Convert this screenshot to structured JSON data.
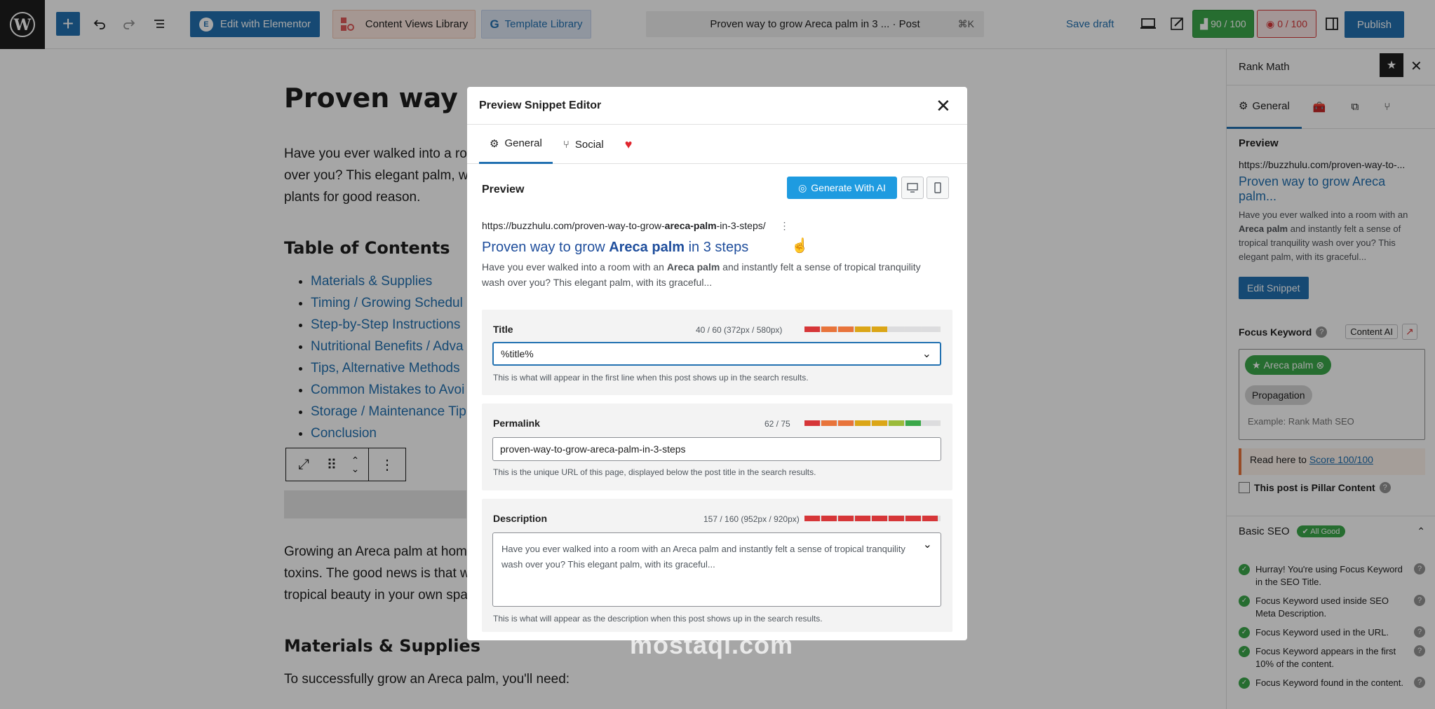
{
  "topbar": {
    "add_label": "+",
    "elementor_label": "Edit with Elementor",
    "elementor_logo": "E",
    "content_views_label": "Content Views Library",
    "template_library_label": "Template Library",
    "command_text": "Proven way to grow Areca palm in 3 ... · Post",
    "command_shortcut": "⌘K",
    "save_draft": "Save draft",
    "seo_score": "90 / 100",
    "readability_score": "0 / 100",
    "publish": "Publish"
  },
  "editor": {
    "title": "Proven way to g",
    "intro_lines": [
      "Have you ever walked into a ro",
      "over you? This elegant palm, w",
      "plants for good reason."
    ],
    "toc_heading": "Table of Contents",
    "toc_items": [
      "Materials & Supplies",
      "Timing / Growing Schedul",
      "Step-by-Step Instructions",
      "Nutritional Benefits / Adva",
      "Tips, Alternative Methods",
      "Common Mistakes to Avoi",
      "Storage / Maintenance Tip",
      "Conclusion"
    ],
    "body_lines": [
      "Growing an Areca palm at hom",
      "toxins. The good news is that w",
      "tropical beauty in your own spa"
    ],
    "materials_heading": "Materials & Supplies",
    "materials_text": "To successfully grow an Areca palm, you'll need:"
  },
  "sidebar": {
    "title": "Rank Math",
    "tab_general": "General",
    "preview_label": "Preview",
    "preview_url": "https://buzzhulu.com/proven-way-to-...",
    "preview_title": "Proven way to grow Areca palm...",
    "preview_desc_1": "Have you ever walked into a room with an",
    "preview_desc_bold": "Areca palm",
    "preview_desc_2": "and instantly felt a sense of tropical tranquility wash over you? This elegant palm, with its graceful...",
    "edit_snippet": "Edit Snippet",
    "focus_keyword_label": "Focus Keyword",
    "content_ai": "Content AI",
    "keywords": [
      "Areca palm",
      "Propagation"
    ],
    "keyword_placeholder": "Example: Rank Math SEO",
    "read_here": "Read here to",
    "score_link": "Score 100/100",
    "pillar_label": "This post is Pillar Content",
    "basic_seo_label": "Basic SEO",
    "all_good": "✔ All Good",
    "checks": [
      "Hurray! You're using Focus Keyword in the SEO Title.",
      "Focus Keyword used inside SEO Meta Description.",
      "Focus Keyword used in the URL.",
      "Focus Keyword appears in the first 10% of the content.",
      "Focus Keyword found in the content."
    ]
  },
  "modal": {
    "title": "Preview Snippet Editor",
    "tab_general": "General",
    "tab_social": "Social",
    "preview_label": "Preview",
    "generate_ai": "Generate With AI",
    "snippet_url_prefix": "https://buzzhulu.com/proven-way-to-grow-",
    "snippet_url_bold": "areca-palm",
    "snippet_url_suffix": "-in-3-steps/",
    "snippet_title_pre": "Proven way to grow ",
    "snippet_title_bold": "Areca palm",
    "snippet_title_post": " in 3 steps",
    "snippet_desc_pre": "Have you ever walked into a room with an ",
    "snippet_desc_bold": "Areca palm",
    "snippet_desc_post": " and instantly felt a sense of tropical tranquility wash over you? This elegant palm, with its graceful...",
    "title_label": "Title",
    "title_count": "40 / 60 (372px / 580px)",
    "title_value": "%title%",
    "title_hint": "This is what will appear in the first line when this post shows up in the search results.",
    "permalink_label": "Permalink",
    "permalink_count": "62 / 75",
    "permalink_value": "proven-way-to-grow-areca-palm-in-3-steps",
    "permalink_hint": "This is the unique URL of this page, displayed below the post title in the search results.",
    "description_label": "Description",
    "description_count": "157 / 160 (952px / 920px)",
    "description_value": "Have you ever walked into a room with an Areca palm and instantly felt a sense of tropical tranquility wash over you? This elegant palm, with its graceful...",
    "description_hint": "This is what will appear as the description when this post shows up in the search results."
  },
  "meters": {
    "title_fill": 0.66,
    "permalink_fill": 0.92,
    "description_fill": 1.0
  },
  "colors": {
    "wp_blue": "#2271b1",
    "ai_blue": "#1e9be0",
    "good_green": "#3ba84a",
    "bad_red": "#d63638"
  },
  "watermark": "mostaql.com"
}
